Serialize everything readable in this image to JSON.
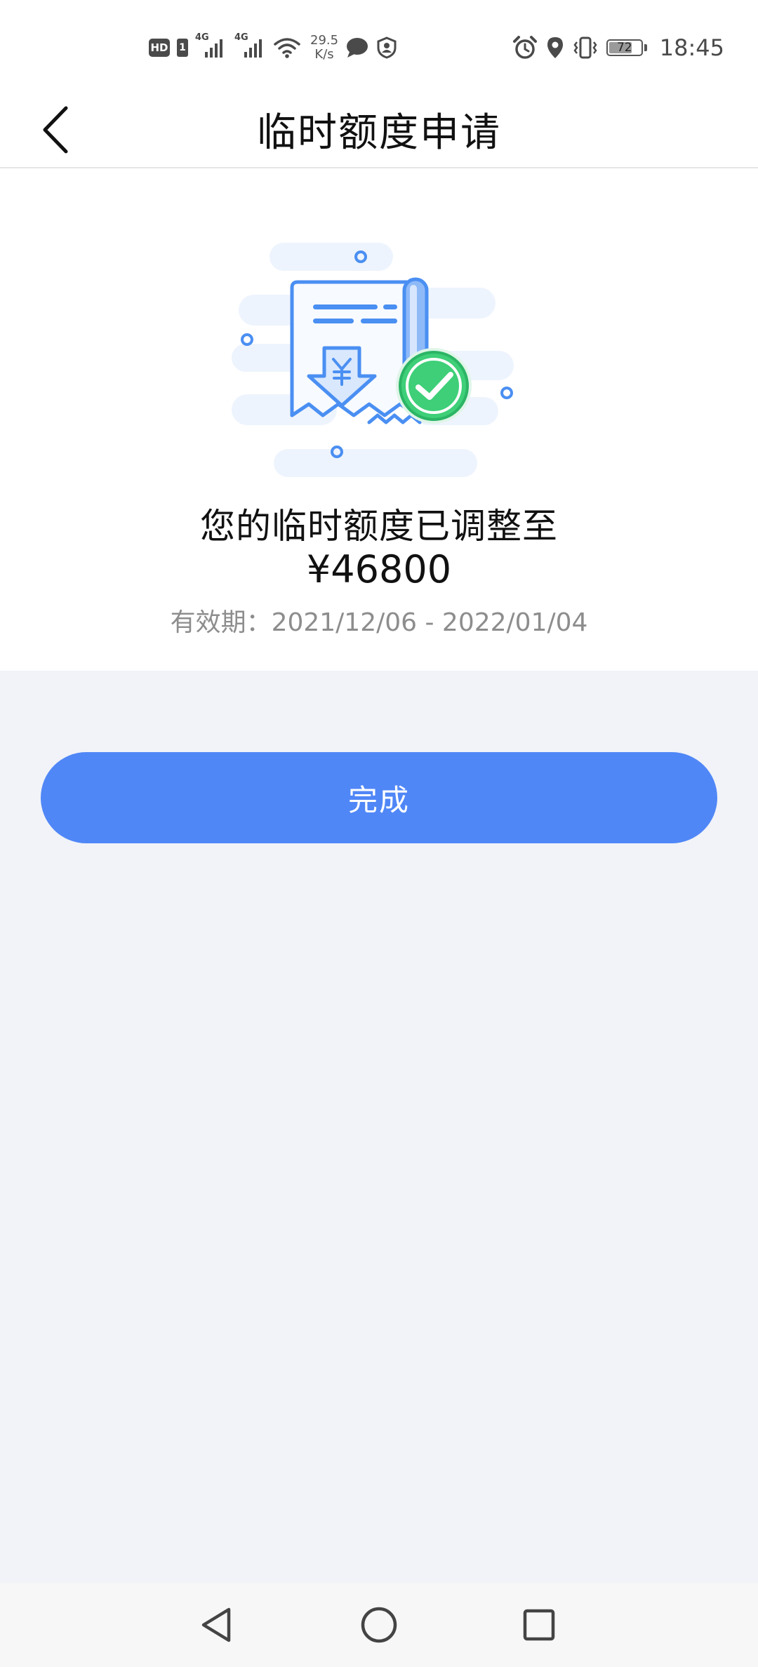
{
  "status_bar": {
    "hd_label": "HD",
    "sim_label": "1",
    "signal1_label": "4G",
    "signal2_label": "4G",
    "net_speed_value": "29.5",
    "net_speed_unit": "K/s",
    "battery_level": "72",
    "time": "18:45",
    "icons": [
      "hd-icon",
      "signal-icon",
      "wifi-icon",
      "message-icon",
      "shield-icon",
      "alarm-icon",
      "location-icon",
      "vibrate-icon",
      "battery-icon"
    ]
  },
  "header": {
    "title": "临时额度申请",
    "back_icon": "chevron-left-icon"
  },
  "result": {
    "illustration": "receipt-success-illustration",
    "title": "您的临时额度已调整至",
    "amount": "¥46800",
    "validity": "有效期：2021/12/06 - 2022/01/04"
  },
  "actions": {
    "done_label": "完成"
  },
  "colors": {
    "primary": "#5087f7",
    "success": "#3ecf78",
    "page_bg": "#f1f3f8",
    "muted_text": "#8d8d8d"
  },
  "nav_bar": {
    "icons": [
      "back-triangle-icon",
      "home-circle-icon",
      "recents-square-icon"
    ]
  }
}
